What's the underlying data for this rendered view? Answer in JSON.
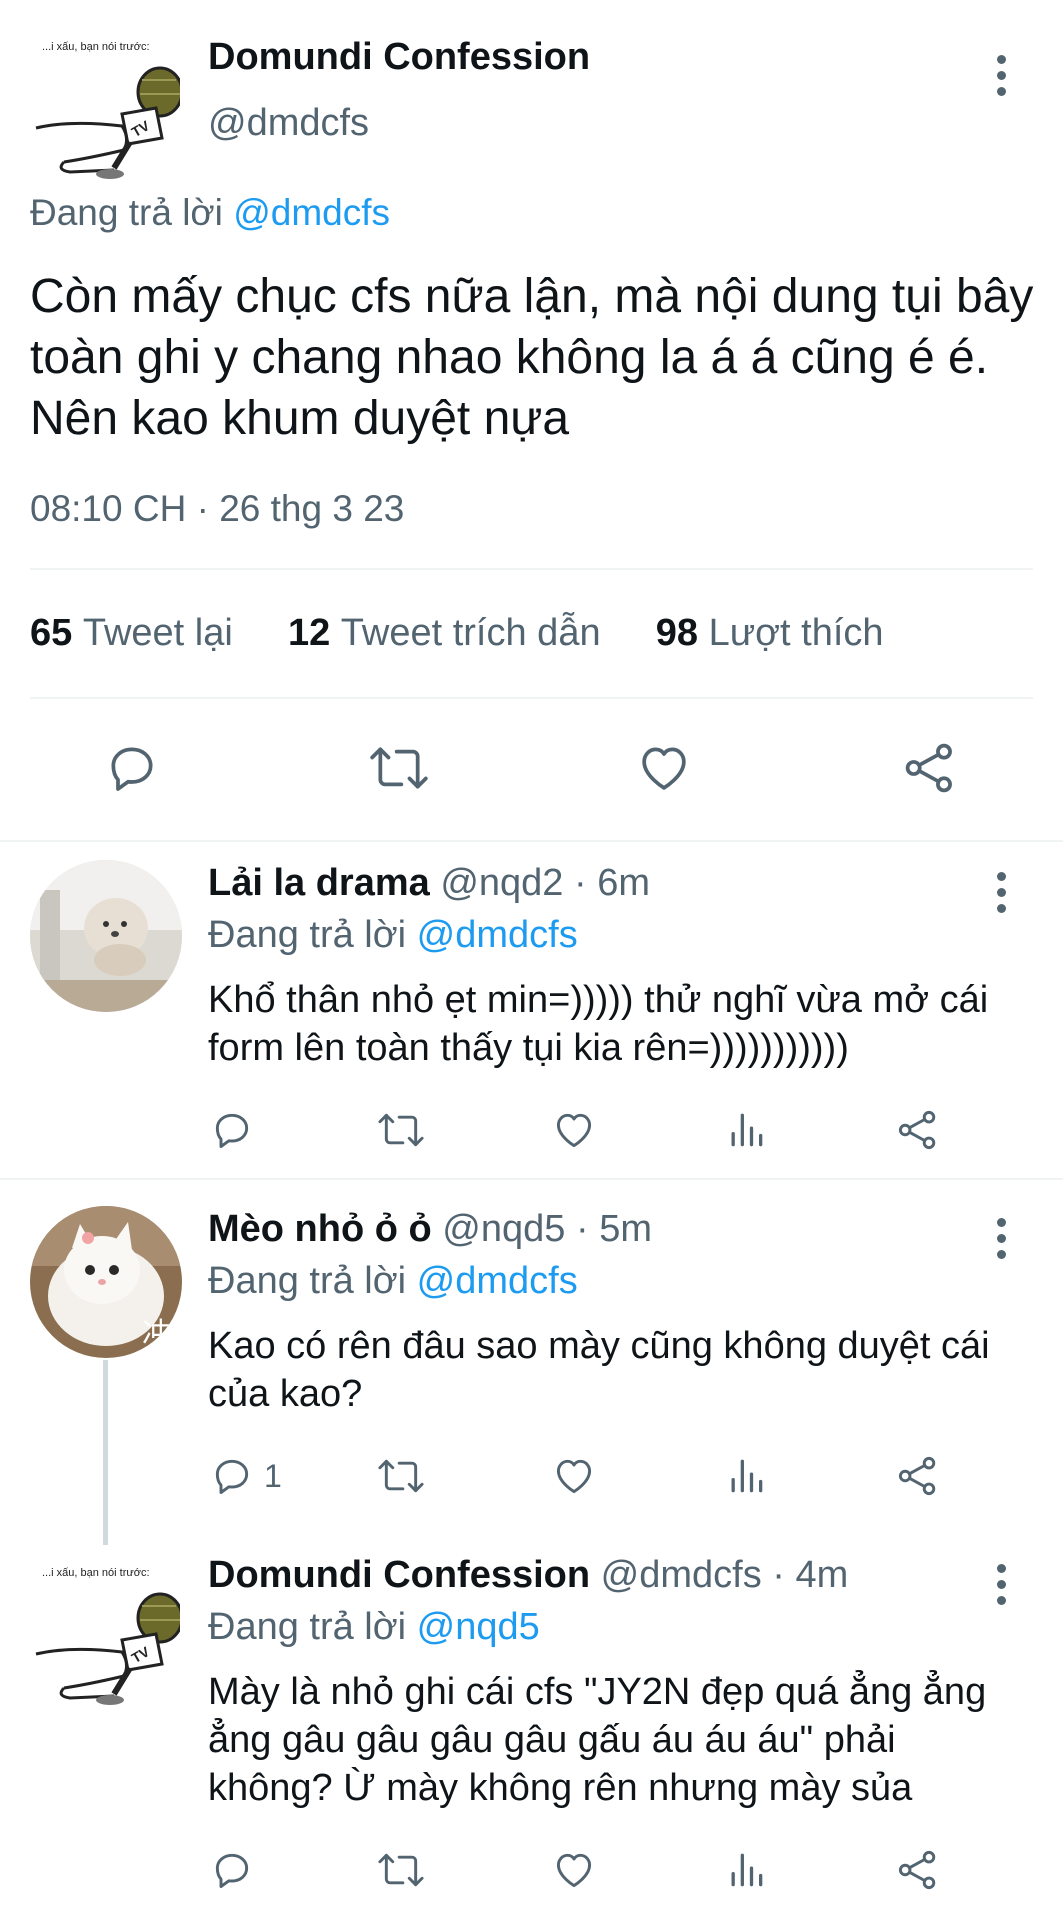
{
  "main_tweet": {
    "author_name": "Domundi Confession",
    "author_handle": "@dmdcfs",
    "avatar_caption": "...i xấu, bạn nói trước:",
    "avatar_tv_label": "TV",
    "reply_prefix": "Đang trả lời",
    "reply_to": "@dmdcfs",
    "text": "Còn mấy chục cfs nữa lận, mà nội dung tụi bây toàn ghi y chang nhao không la á á cũng é é. Nên kao khum duyệt nựa",
    "timestamp": "08:10 CH · 26 thg 3 23",
    "stats": {
      "retweets_count": "65",
      "retweets_label": "Tweet lại",
      "quotes_count": "12",
      "quotes_label": "Tweet trích dẫn",
      "likes_count": "98",
      "likes_label": "Lượt thích"
    },
    "actions": [
      "reply-icon",
      "retweet-icon",
      "like-icon",
      "share-icon"
    ]
  },
  "replies": [
    {
      "name": "Lải la drama",
      "handle": "@nqd2",
      "time": "· 6m",
      "reply_prefix": "Đang trả lời",
      "reply_to": "@dmdcfs",
      "text": "Khổ thân nhỏ ẹt min=))))) thử nghĩ vừa mở cái form lên toàn thấy tụi kia rên=)))))))))))",
      "reply_count": ""
    },
    {
      "name": "Mèo nhỏ ỏ ỏ",
      "handle": "@nqd5",
      "time": "· 5m",
      "reply_prefix": "Đang trả lời",
      "reply_to": "@dmdcfs",
      "text": "Kao có rên đâu sao mày cũng không duyệt cái của kao?",
      "reply_count": "1",
      "avatar_overlay": "冲"
    },
    {
      "name": "Domundi Confession",
      "handle": "@dmdcfs",
      "time": "· 4m",
      "reply_prefix": "Đang trả lời",
      "reply_to": "@nqd5",
      "text": "Mày là nhỏ ghi cái cfs \"JY2N đẹp quá ẳng ẳng ẳng gâu gâu gâu gâu gấu áu áu áu\" phải không? Ừ mày không rên nhưng mày sủa",
      "reply_count": ""
    }
  ],
  "colors": {
    "text": "#0f1419",
    "secondary": "#536471",
    "link": "#1d9bf0",
    "divider": "#eff3f4"
  }
}
